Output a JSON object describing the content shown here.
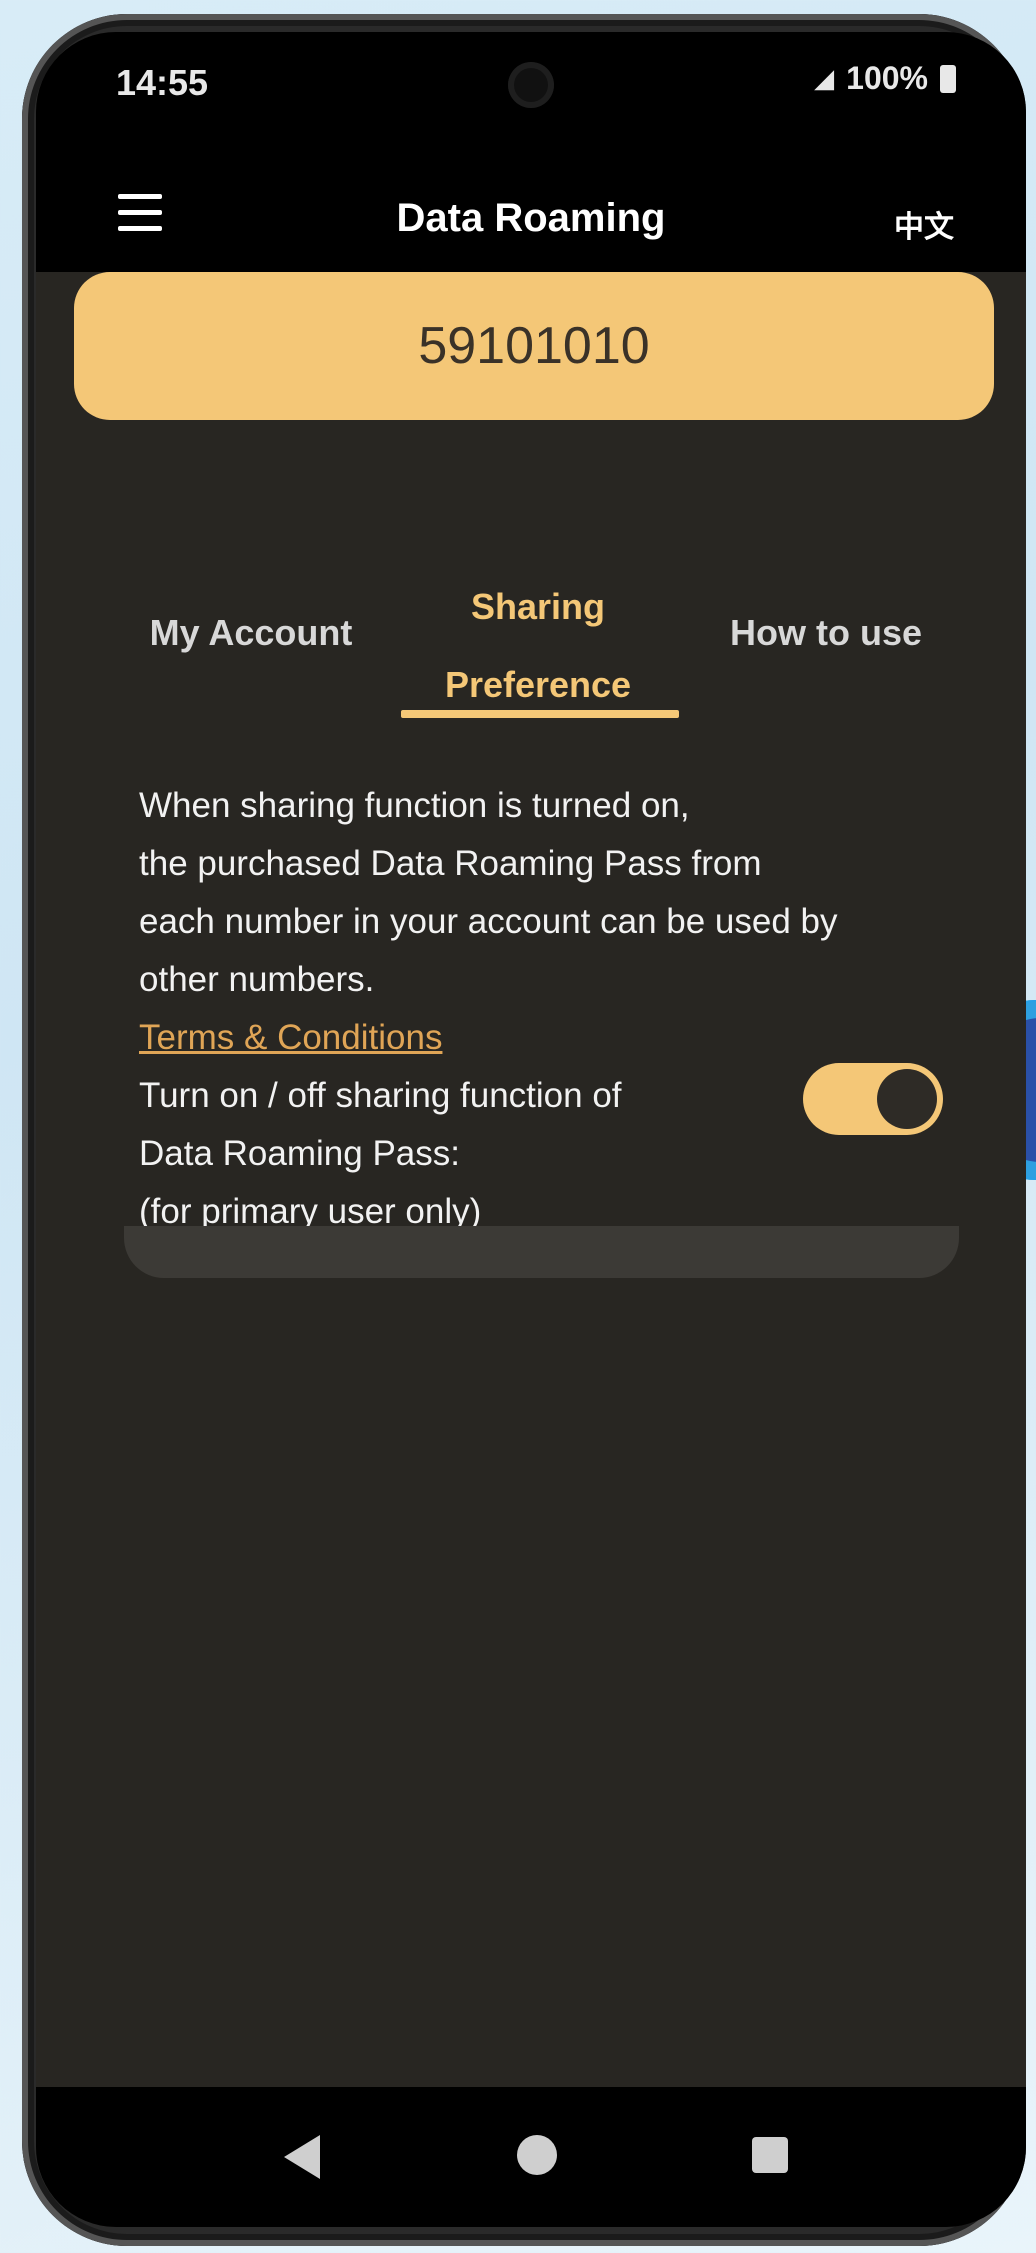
{
  "status_bar": {
    "time": "14:55",
    "battery": "100%"
  },
  "header": {
    "title": "Data Roaming",
    "language_toggle": "中文"
  },
  "account_number": "59101010",
  "tabs": [
    {
      "label": "My Account",
      "active": false
    },
    {
      "label": "Sharing\nPreference",
      "active": true
    },
    {
      "label": "How to use",
      "active": false
    }
  ],
  "sharing": {
    "description": "When sharing function is turned on,\nthe purchased Data Roaming Pass from\neach number in your account can be used by\nother numbers.",
    "terms_link": "Terms & Conditions",
    "toggle_label": "Turn on / off sharing function of\nData Roaming Pass:\n(for primary user only)",
    "toggle_state": "on"
  },
  "colors": {
    "accent": "#f4c777",
    "background": "#282622",
    "link": "#e0a556"
  },
  "icons": {
    "menu": "hamburger-icon",
    "nav_back": "triangle-back-icon",
    "nav_home": "circle-home-icon",
    "nav_recent": "square-recent-icon"
  }
}
